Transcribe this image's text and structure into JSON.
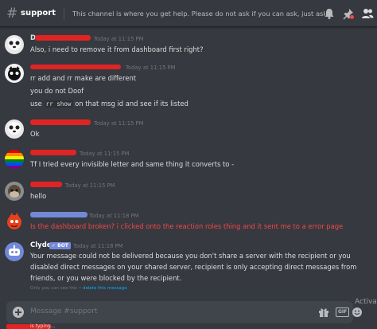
{
  "header": {
    "channel": "support",
    "topic": "This channel is where you get help. Please do not ask if you can ask, just ask! Being specific a..."
  },
  "messages": [
    {
      "username": "D... ...",
      "username_color": "#dcddde",
      "timestamp": "Today at 11:15 PM",
      "lines": [
        "Also, i need to remove it from dashboard first right?"
      ]
    },
    {
      "username": "",
      "timestamp": "Today at 11:15 PM",
      "lines": [
        "rr add and rr make are different",
        "you do not Doof"
      ],
      "code_line": {
        "before": "use ",
        "code": "rr show",
        "after": " on that msg id and see if its listed"
      }
    },
    {
      "username": "",
      "timestamp": "Today at 11:15 PM",
      "lines": [
        "Ok"
      ]
    },
    {
      "username": "",
      "timestamp": "Today at 11:15 PM",
      "lines": [
        "Tf I tried every invisible letter and  same thing it converts to -"
      ]
    },
    {
      "username": "",
      "timestamp": "Today at 11:15 PM",
      "lines": [
        "hello"
      ]
    },
    {
      "username": "",
      "timestamp": "Today at 11:18 PM",
      "lines": [
        "Is the dashboard broken? i clicked onto the reaction roles thing and it sent me to a error page"
      ]
    },
    {
      "username": "Clyde",
      "badge": "✓ BOT",
      "timestamp": "Today at 11:18 PM",
      "lines": [
        "Your message could not be delivered because you don't share a server with the recipient or you",
        "disabled direct messages on your shared server, recipient is only accepting direct messages from",
        "friends, or you were blocked by the recipient."
      ],
      "ephemeral": {
        "text": "Only you can see this  •  ",
        "link": "delete this message"
      }
    }
  ],
  "input": {
    "placeholder": "Message #support"
  },
  "footer": {
    "typing": "is typing...",
    "activate": "Activa"
  },
  "colors": {
    "background": "#36393f",
    "redaction": "#e02424",
    "blurple": "#7289da",
    "error_text": "#f04747"
  }
}
